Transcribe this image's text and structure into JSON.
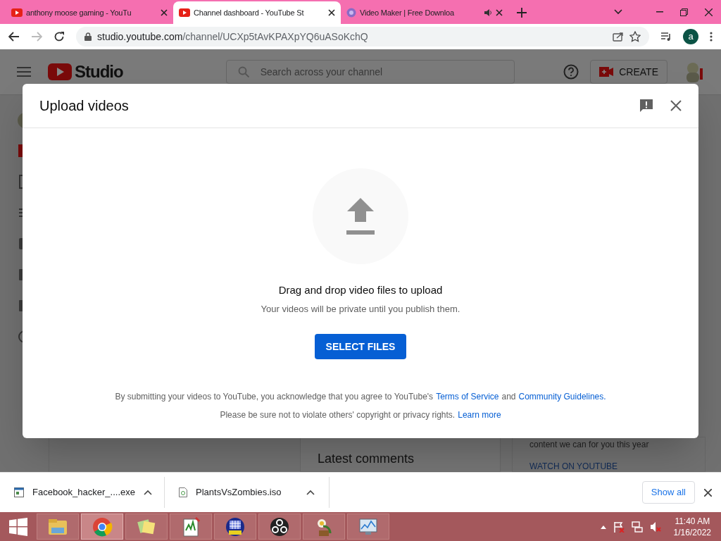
{
  "browser": {
    "tabs": [
      {
        "title": "anthony moose gaming - YouTu",
        "kind": "youtube",
        "audio": false,
        "selected": false
      },
      {
        "title": "Channel dashboard - YouTube St",
        "kind": "youtube",
        "audio": false,
        "selected": true
      },
      {
        "title": "Video Maker | Free Downloa",
        "kind": "globe",
        "audio": true,
        "selected": false
      }
    ],
    "url_host": "studio.youtube.com",
    "url_path": "/channel/UCXp5tAvKPAXpYQ6uASoKchQ",
    "profile_initial": "a"
  },
  "studio": {
    "logo": "Studio",
    "search_placeholder": "Search across your channel",
    "create_label": "CREATE",
    "card_heading": "Latest comments",
    "card_text": "content we can for you this year",
    "card_link": "WATCH ON YOUTUBE"
  },
  "dialog": {
    "title": "Upload videos",
    "headline": "Drag and drop video files to upload",
    "subline": "Your videos will be private until you publish them.",
    "button": "SELECT FILES",
    "legal_1": "By submitting your videos to YouTube, you acknowledge that you agree to YouTube's",
    "link_terms": "Terms of Service",
    "legal_and": "and",
    "link_guidelines": "Community Guidelines.",
    "legal_2": "Please be sure not to violate others' copyright or privacy rights.",
    "link_learn": "Learn more"
  },
  "downloads": {
    "items": [
      {
        "name": "Facebook_hacker_....exe",
        "kind": "exe"
      },
      {
        "name": "PlantsVsZombies.iso",
        "kind": "iso"
      }
    ],
    "show_all": "Show all"
  },
  "taskbar": {
    "apps": [
      {
        "kind": "folder",
        "selected": false
      },
      {
        "kind": "chrome",
        "selected": true
      },
      {
        "kind": "notes",
        "selected": false
      },
      {
        "kind": "editor",
        "selected": false
      },
      {
        "kind": "game",
        "selected": false
      },
      {
        "kind": "obs",
        "selected": false
      },
      {
        "kind": "plant",
        "selected": false
      },
      {
        "kind": "monitor",
        "selected": false
      }
    ],
    "time": "11:40 AM",
    "date": "1/16/2022"
  }
}
